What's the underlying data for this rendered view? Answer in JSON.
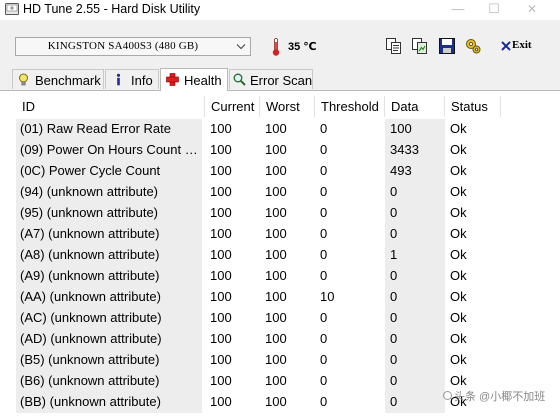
{
  "window": {
    "title": "HD Tune 2.55 - Hard Disk Utility",
    "minimize_glyph": "—",
    "maximize_glyph": "☐",
    "close_glyph": "✕"
  },
  "toolbar": {
    "drive": "KINGSTON SA400S3 (480 GB)",
    "temperature": "35 ℃",
    "exit_label": "Exit",
    "icons": [
      "copy-text-icon",
      "copy-screenshot-icon",
      "save-icon",
      "options-icon",
      "exit-icon"
    ]
  },
  "tabs": [
    {
      "label": "Benchmark",
      "icon": "lightbulb-icon"
    },
    {
      "label": "Info",
      "icon": "info-icon"
    },
    {
      "label": "Health",
      "icon": "red-cross-icon",
      "active": true
    },
    {
      "label": "Error Scan",
      "icon": "magnifier-icon"
    }
  ],
  "table": {
    "headers": [
      "ID",
      "Current",
      "Worst",
      "Threshold",
      "Data",
      "Status"
    ],
    "rows": [
      [
        "(01) Raw Read Error Rate",
        "100",
        "100",
        "0",
        "100",
        "Ok"
      ],
      [
        "(09) Power On Hours Count  …",
        "100",
        "100",
        "0",
        "3433",
        "Ok"
      ],
      [
        "(0C) Power Cycle Count",
        "100",
        "100",
        "0",
        "493",
        "Ok"
      ],
      [
        "(94) (unknown attribute)",
        "100",
        "100",
        "0",
        "0",
        "Ok"
      ],
      [
        "(95) (unknown attribute)",
        "100",
        "100",
        "0",
        "0",
        "Ok"
      ],
      [
        "(A7) (unknown attribute)",
        "100",
        "100",
        "0",
        "0",
        "Ok"
      ],
      [
        "(A8) (unknown attribute)",
        "100",
        "100",
        "0",
        "1",
        "Ok"
      ],
      [
        "(A9) (unknown attribute)",
        "100",
        "100",
        "0",
        "0",
        "Ok"
      ],
      [
        "(AA) (unknown attribute)",
        "100",
        "100",
        "10",
        "0",
        "Ok"
      ],
      [
        "(AC) (unknown attribute)",
        "100",
        "100",
        "0",
        "0",
        "Ok"
      ],
      [
        "(AD) (unknown attribute)",
        "100",
        "100",
        "0",
        "0",
        "Ok"
      ],
      [
        "(B5) (unknown attribute)",
        "100",
        "100",
        "0",
        "0",
        "Ok"
      ],
      [
        "(B6) (unknown attribute)",
        "100",
        "100",
        "0",
        "0",
        "Ok"
      ],
      [
        "(BB) (unknown attribute)",
        "100",
        "100",
        "0",
        "0",
        "Ok"
      ]
    ]
  },
  "watermark": "头条 @小椰不加班"
}
